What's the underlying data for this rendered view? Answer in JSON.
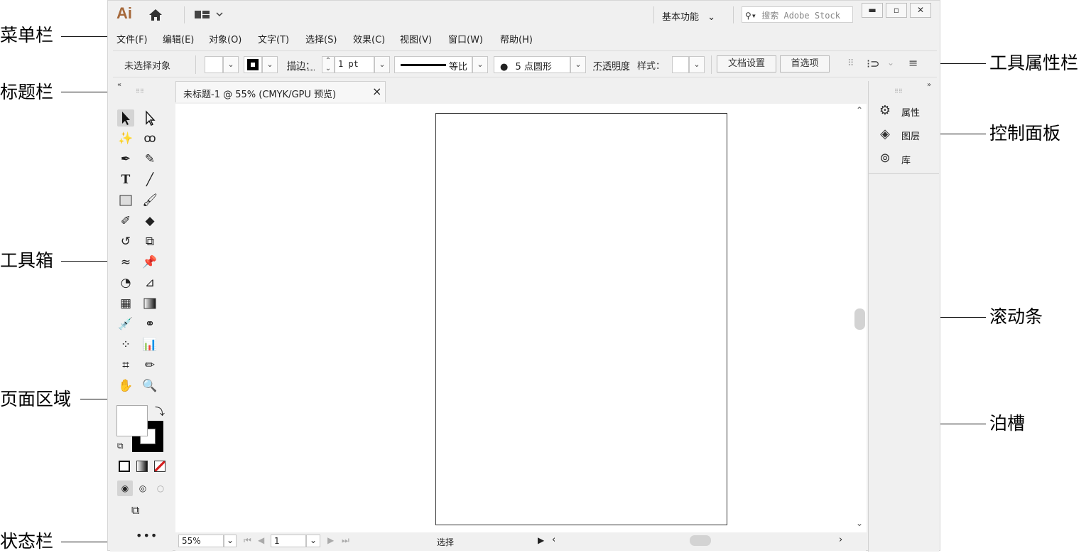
{
  "callouts": {
    "menubar": "菜单栏",
    "titlebar": "标题栏",
    "toolbox": "工具箱",
    "page_area": "页面区域",
    "statusbar": "状态栏",
    "tool_properties": "工具属性栏",
    "control_panel": "控制面板",
    "scrollbar": "滚动条",
    "dock": "泊槽"
  },
  "titlebar": {
    "logo": "Ai",
    "workspace": "基本功能",
    "search_placeholder": "搜索 Adobe Stock"
  },
  "menu": [
    "文件(F)",
    "编辑(E)",
    "对象(O)",
    "文字(T)",
    "选择(S)",
    "效果(C)",
    "视图(V)",
    "窗口(W)",
    "帮助(H)"
  ],
  "control_bar": {
    "selection_status": "未选择对象",
    "stroke_label": "描边：",
    "stroke_value": "1 pt",
    "profile_label": "等比",
    "brush_label": "5 点圆形",
    "opacity_label": "不透明度",
    "style_label": "样式：",
    "doc_setup_button": "文档设置",
    "preferences_button": "首选项"
  },
  "document": {
    "tab_title": "未标题-1 @ 55% (CMYK/GPU 预览)",
    "close": "×"
  },
  "statusbar": {
    "zoom": "55%",
    "page": "1",
    "tool_status": "选择"
  },
  "panels": [
    {
      "label": "属性",
      "icon": "properties-icon"
    },
    {
      "label": "图层",
      "icon": "layers-icon"
    },
    {
      "label": "库",
      "icon": "libraries-icon"
    }
  ],
  "colors": {
    "accent_logo": "#a5683a",
    "ui_gray": "#f0f0f0",
    "fill_none_red": "#d62020"
  }
}
